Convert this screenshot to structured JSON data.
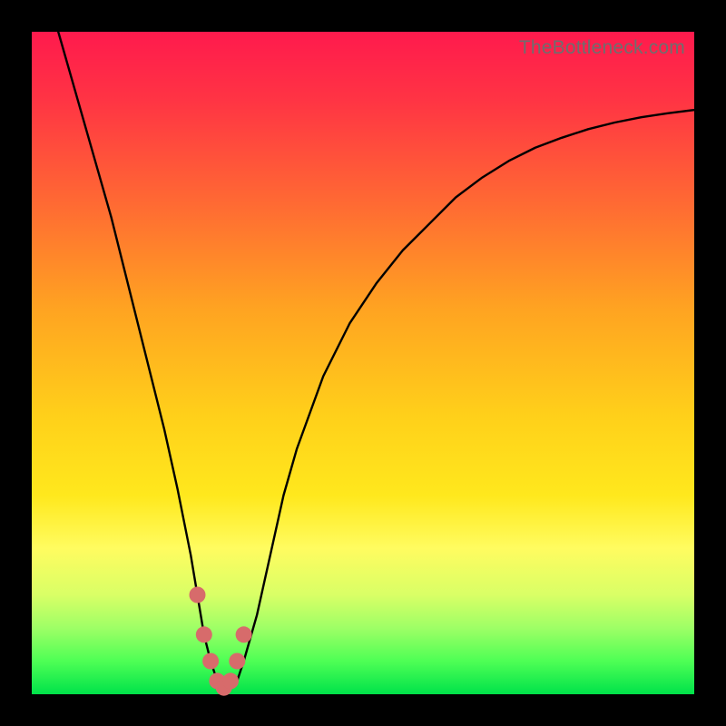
{
  "attribution": "TheBottleneck.com",
  "chart_data": {
    "type": "line",
    "title": "",
    "xlabel": "",
    "ylabel": "",
    "xlim": [
      0,
      100
    ],
    "ylim": [
      0,
      100
    ],
    "grid": false,
    "legend": false,
    "series": [
      {
        "name": "bottleneck-curve",
        "color": "#000000",
        "x": [
          4,
          6,
          8,
          10,
          12,
          14,
          16,
          18,
          20,
          22,
          24,
          25,
          26,
          27,
          28,
          29,
          30,
          31,
          32,
          34,
          36,
          38,
          40,
          44,
          48,
          52,
          56,
          60,
          64,
          68,
          72,
          76,
          80,
          84,
          88,
          92,
          96,
          100
        ],
        "y": [
          100,
          93,
          86,
          79,
          72,
          64,
          56,
          48,
          40,
          31,
          21,
          15,
          9,
          5,
          2,
          1,
          1,
          2,
          5,
          12,
          21,
          30,
          37,
          48,
          56,
          62,
          67,
          71,
          75,
          78,
          80.5,
          82.5,
          84,
          85.3,
          86.3,
          87.1,
          87.7,
          88.2
        ]
      },
      {
        "name": "highlight-dots",
        "color": "#d76b6b",
        "x": [
          25,
          26,
          27,
          28,
          29,
          30,
          31,
          32
        ],
        "y": [
          15,
          9,
          5,
          2,
          1,
          2,
          5,
          9
        ]
      }
    ]
  }
}
